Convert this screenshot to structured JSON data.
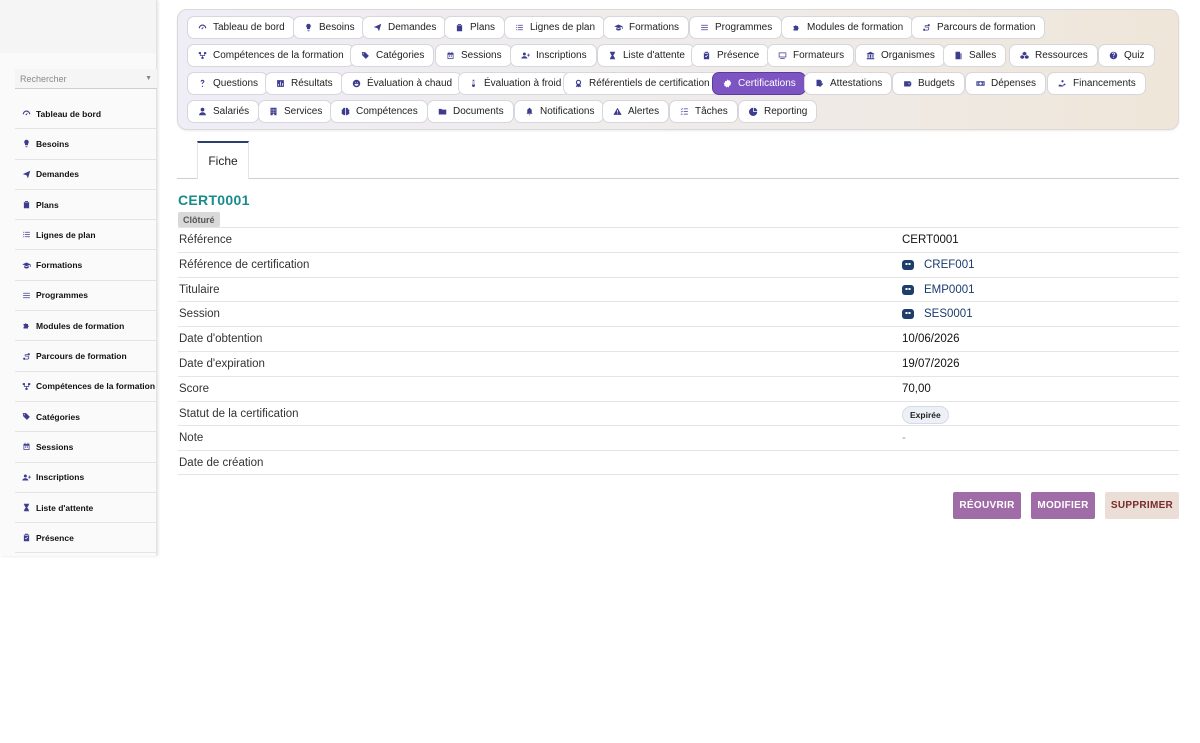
{
  "sidebar": {
    "search_placeholder": "Rechercher",
    "items": [
      {
        "label": "Tableau de bord",
        "icon": "gauge-icon"
      },
      {
        "label": "Besoins",
        "icon": "lightbulb-icon"
      },
      {
        "label": "Demandes",
        "icon": "paper-plane-icon"
      },
      {
        "label": "Plans",
        "icon": "clipboard-icon"
      },
      {
        "label": "Lignes de plan",
        "icon": "list-icon"
      },
      {
        "label": "Formations",
        "icon": "graduation-cap-icon"
      },
      {
        "label": "Programmes",
        "icon": "bars-icon"
      },
      {
        "label": "Modules de formation",
        "icon": "puzzle-icon"
      },
      {
        "label": "Parcours de formation",
        "icon": "route-icon"
      },
      {
        "label": "Compétences de la formation",
        "icon": "diagram-icon"
      },
      {
        "label": "Catégories",
        "icon": "tags-icon"
      },
      {
        "label": "Sessions",
        "icon": "calendar-icon"
      },
      {
        "label": "Inscriptions",
        "icon": "user-plus-icon"
      },
      {
        "label": "Liste d'attente",
        "icon": "hourglass-icon"
      },
      {
        "label": "Présence",
        "icon": "clipboard-check-icon"
      }
    ]
  },
  "nav": {
    "active": "Certifications",
    "rows": [
      [
        {
          "label": "Tableau de bord",
          "icon": "gauge-icon"
        },
        {
          "label": "Besoins",
          "icon": "lightbulb-icon"
        },
        {
          "label": "Demandes",
          "icon": "paper-plane-icon"
        },
        {
          "label": "Plans",
          "icon": "clipboard-icon"
        },
        {
          "label": "Lignes de plan",
          "icon": "list-icon"
        },
        {
          "label": "Formations",
          "icon": "graduation-cap-icon"
        },
        {
          "label": "Programmes",
          "icon": "bars-icon"
        },
        {
          "label": "Modules de formation",
          "icon": "puzzle-icon"
        },
        {
          "label": "Parcours de formation",
          "icon": "route-icon"
        }
      ],
      [
        {
          "label": "Compétences de la formation",
          "icon": "diagram-icon"
        },
        {
          "label": "Catégories",
          "icon": "tags-icon"
        },
        {
          "label": "Sessions",
          "icon": "calendar-icon"
        },
        {
          "label": "Inscriptions",
          "icon": "user-plus-icon"
        },
        {
          "label": "Liste d'attente",
          "icon": "hourglass-icon"
        },
        {
          "label": "Présence",
          "icon": "clipboard-check-icon"
        },
        {
          "label": "Formateurs",
          "icon": "chalkboard-icon"
        },
        {
          "label": "Organismes",
          "icon": "landmark-icon"
        },
        {
          "label": "Salles",
          "icon": "door-icon"
        },
        {
          "label": "Ressources",
          "icon": "cubes-icon"
        },
        {
          "label": "Quiz",
          "icon": "question-circle-icon"
        }
      ],
      [
        {
          "label": "Questions",
          "icon": "question-icon"
        },
        {
          "label": "Résultats",
          "icon": "poll-icon"
        },
        {
          "label": "Évaluation à chaud",
          "icon": "smile-icon"
        },
        {
          "label": "Évaluation à froid",
          "icon": "thermometer-icon"
        },
        {
          "label": "Référentiels de certification",
          "icon": "award-icon"
        },
        {
          "label": "Certifications",
          "icon": "certificate-icon"
        },
        {
          "label": "Attestations",
          "icon": "file-signature-icon"
        },
        {
          "label": "Budgets",
          "icon": "wallet-icon"
        },
        {
          "label": "Dépenses",
          "icon": "money-bill-icon"
        },
        {
          "label": "Financements",
          "icon": "hand-holding-icon"
        }
      ],
      [
        {
          "label": "Salariés",
          "icon": "user-icon"
        },
        {
          "label": "Services",
          "icon": "building-icon"
        },
        {
          "label": "Compétences",
          "icon": "brain-icon"
        },
        {
          "label": "Documents",
          "icon": "folder-icon"
        },
        {
          "label": "Notifications",
          "icon": "bell-icon"
        },
        {
          "label": "Alertes",
          "icon": "warning-icon"
        },
        {
          "label": "Tâches",
          "icon": "tasks-icon"
        },
        {
          "label": "Reporting",
          "icon": "chart-pie-icon"
        }
      ]
    ]
  },
  "tabs": [
    {
      "label": "Fiche"
    }
  ],
  "record": {
    "title": "CERT0001",
    "status_badge": "Clôturé",
    "fields": [
      {
        "label": "Référence",
        "value": "CERT0001",
        "kind": "text"
      },
      {
        "label": "Référence de certification",
        "value": "CREF001",
        "kind": "link"
      },
      {
        "label": "Titulaire",
        "value": "EMP0001",
        "kind": "link"
      },
      {
        "label": "Session",
        "value": "SES0001",
        "kind": "link"
      },
      {
        "label": "Date d'obtention",
        "value": "10/06/2026",
        "kind": "text"
      },
      {
        "label": "Date d'expiration",
        "value": "19/07/2026",
        "kind": "text"
      },
      {
        "label": "Score",
        "value": "70,00",
        "kind": "text"
      },
      {
        "label": "Statut de la certification",
        "value": "Expirée",
        "kind": "pill"
      },
      {
        "label": "Note",
        "value": "-",
        "kind": "dash"
      },
      {
        "label": "Date de création",
        "value": "",
        "kind": "text"
      }
    ]
  },
  "actions": {
    "reopen": "RÉOUVRIR",
    "edit": "MODIFIER",
    "delete": "SUPPRIMER"
  },
  "colors": {
    "active_chip": "#7d55c2",
    "title": "#1a8a8a",
    "link": "#1a3b6e",
    "action_primary": "#a06ca8",
    "action_danger_bg": "#eaded6"
  }
}
